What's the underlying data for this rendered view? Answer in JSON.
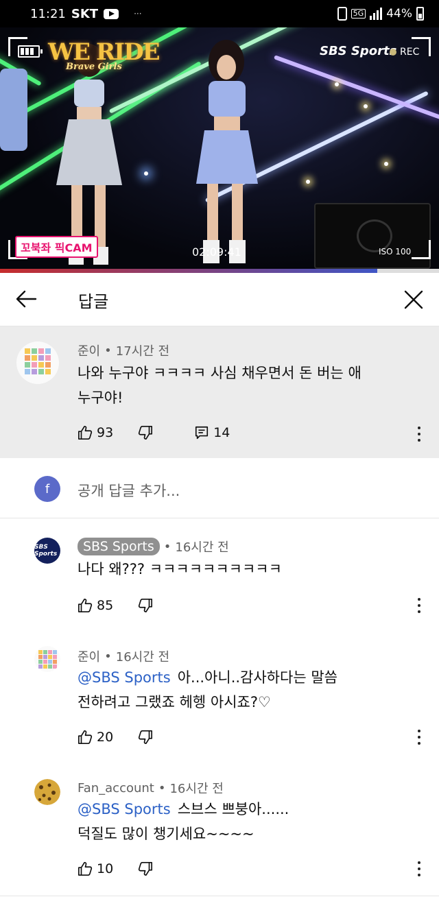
{
  "status_bar": {
    "time": "11:21",
    "carrier": "SKT",
    "network": "5G",
    "battery": "44%"
  },
  "video": {
    "show_title": "WE RIDE",
    "show_subtitle": "Brave Girls",
    "broadcaster": "SBS Sports",
    "rec_label": "REC",
    "cam_label": "꼬북좌 픽CAM",
    "timecode": "02:09:41",
    "iso_label": "ISO 100",
    "progress": 0.86
  },
  "header": {
    "title": "답글"
  },
  "parent_comment": {
    "author": "준이",
    "time": "17시간 전",
    "text_line1": "나와 누구야 ㅋㅋㅋㅋ 사심 채우면서 돈 버는 애",
    "text_line2": "누구야!",
    "likes": "93",
    "replies": "14"
  },
  "add_reply": {
    "avatar_letter": "f",
    "placeholder": "공개 답글 추가..."
  },
  "replies": [
    {
      "author": "SBS Sports",
      "time": "16시간 전",
      "text_line1": "나다 왜??? ㅋㅋㅋㅋㅋㅋㅋㅋㅋㅋ",
      "likes": "85"
    },
    {
      "author": "준이",
      "time": "16시간 전",
      "mention": "@SBS Sports",
      "text_line1": "아...아니..감사하다는 말씀",
      "text_line2": "전하려고 그랬죠 헤헹 아시죠?♡",
      "likes": "20"
    },
    {
      "author": "Fan_account",
      "time": "16시간 전",
      "mention": "@SBS Sports",
      "text_line1": "스브스 쁘붕아......",
      "text_line2": "덕질도 많이 챙기세요~~~~",
      "likes": "10"
    }
  ],
  "icons": [
    "back-arrow-icon",
    "close-icon",
    "thumb-up-icon",
    "thumb-down-icon",
    "reply-icon",
    "more-vert-icon"
  ]
}
